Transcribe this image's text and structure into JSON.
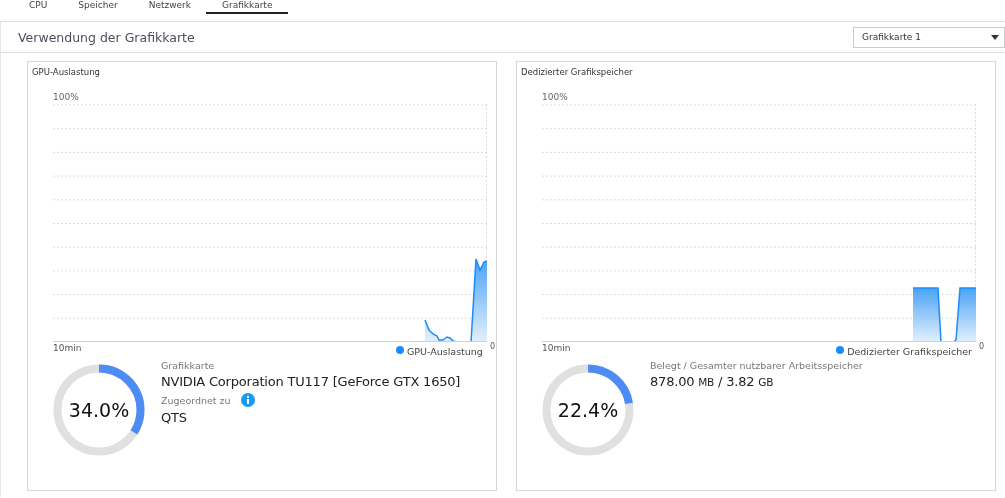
{
  "tabs": [
    {
      "label": "CPU",
      "selected": false
    },
    {
      "label": "Speicher",
      "selected": false
    },
    {
      "label": "Netzwerk",
      "selected": false
    },
    {
      "label": "Grafikkarte",
      "selected": true
    }
  ],
  "section": {
    "title": "Verwendung der Grafikkarte",
    "dropdown": {
      "value": "Grafikkarte 1"
    }
  },
  "panels": [
    {
      "kind": "gpu",
      "title": "GPU-Auslastung",
      "chart": {
        "y_top_label": "100%",
        "x_start_label": "10min",
        "x_end_label": "0",
        "legend": "GPU-Auslastung"
      },
      "gauge": {
        "level": 0.34,
        "reading": "34.0%"
      },
      "info": {
        "label": "Grafikkarte",
        "value": "NVIDIA Corporation TU117 [GeForce GTX 1650]",
        "assigned_label": "Zugeordnet zu",
        "assigned_value": "QTS"
      }
    },
    {
      "kind": "memory",
      "title": "Dedizierter Grafikspeicher",
      "chart": {
        "y_top_label": "100%",
        "x_start_label": "10min",
        "x_end_label": "0",
        "legend": "Dedizierter Grafikspeicher"
      },
      "gauge": {
        "level": 0.224,
        "reading": "22.4%"
      },
      "info": {
        "label": "Belegt / Gesamter nutzbarer Arbeitsspeicher",
        "used": "878.00",
        "used_unit": "MB",
        "separator": "/",
        "total": "3.82",
        "total_unit": "GB"
      }
    }
  ]
}
